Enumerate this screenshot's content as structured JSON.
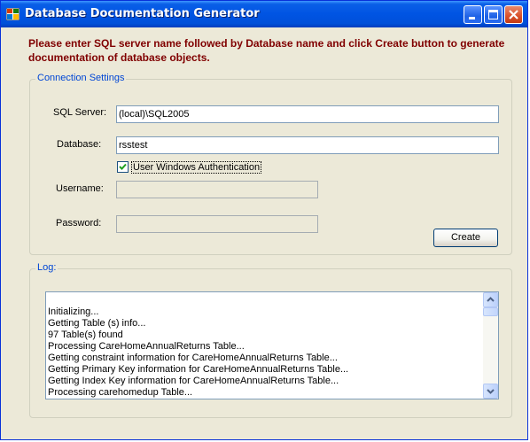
{
  "window": {
    "title": "Database Documentation Generator",
    "accent_color": "#0054e3",
    "icons": [
      "app-icon",
      "minimize-icon",
      "maximize-icon",
      "close-icon"
    ]
  },
  "instructions": "Please enter SQL server name followed by Database name and click Create button to generate documentation of database objects.",
  "instructions_color": "#800000",
  "connection": {
    "group_label": "Connection Settings",
    "server_label": "SQL Server:",
    "server_value": "(local)\\SQL2005",
    "database_label": "Database:",
    "database_value": "rsstest",
    "windows_auth_label": "User Windows Authentication",
    "windows_auth_checked": true,
    "username_label": "Username:",
    "username_value": "",
    "password_label": "Password:",
    "password_value": "",
    "create_button": "Create"
  },
  "log": {
    "group_label": "Log:",
    "lines": [
      "Initializing...",
      "Getting Table (s) info...",
      "97 Table(s) found",
      "Processing CareHomeAnnualReturns Table...",
      "Getting constraint information for CareHomeAnnualReturns Table...",
      "Getting Primary Key information for CareHomeAnnualReturns Table...",
      "Getting Index Key information for CareHomeAnnualReturns Table...",
      "Processing carehomedup Table..."
    ]
  }
}
